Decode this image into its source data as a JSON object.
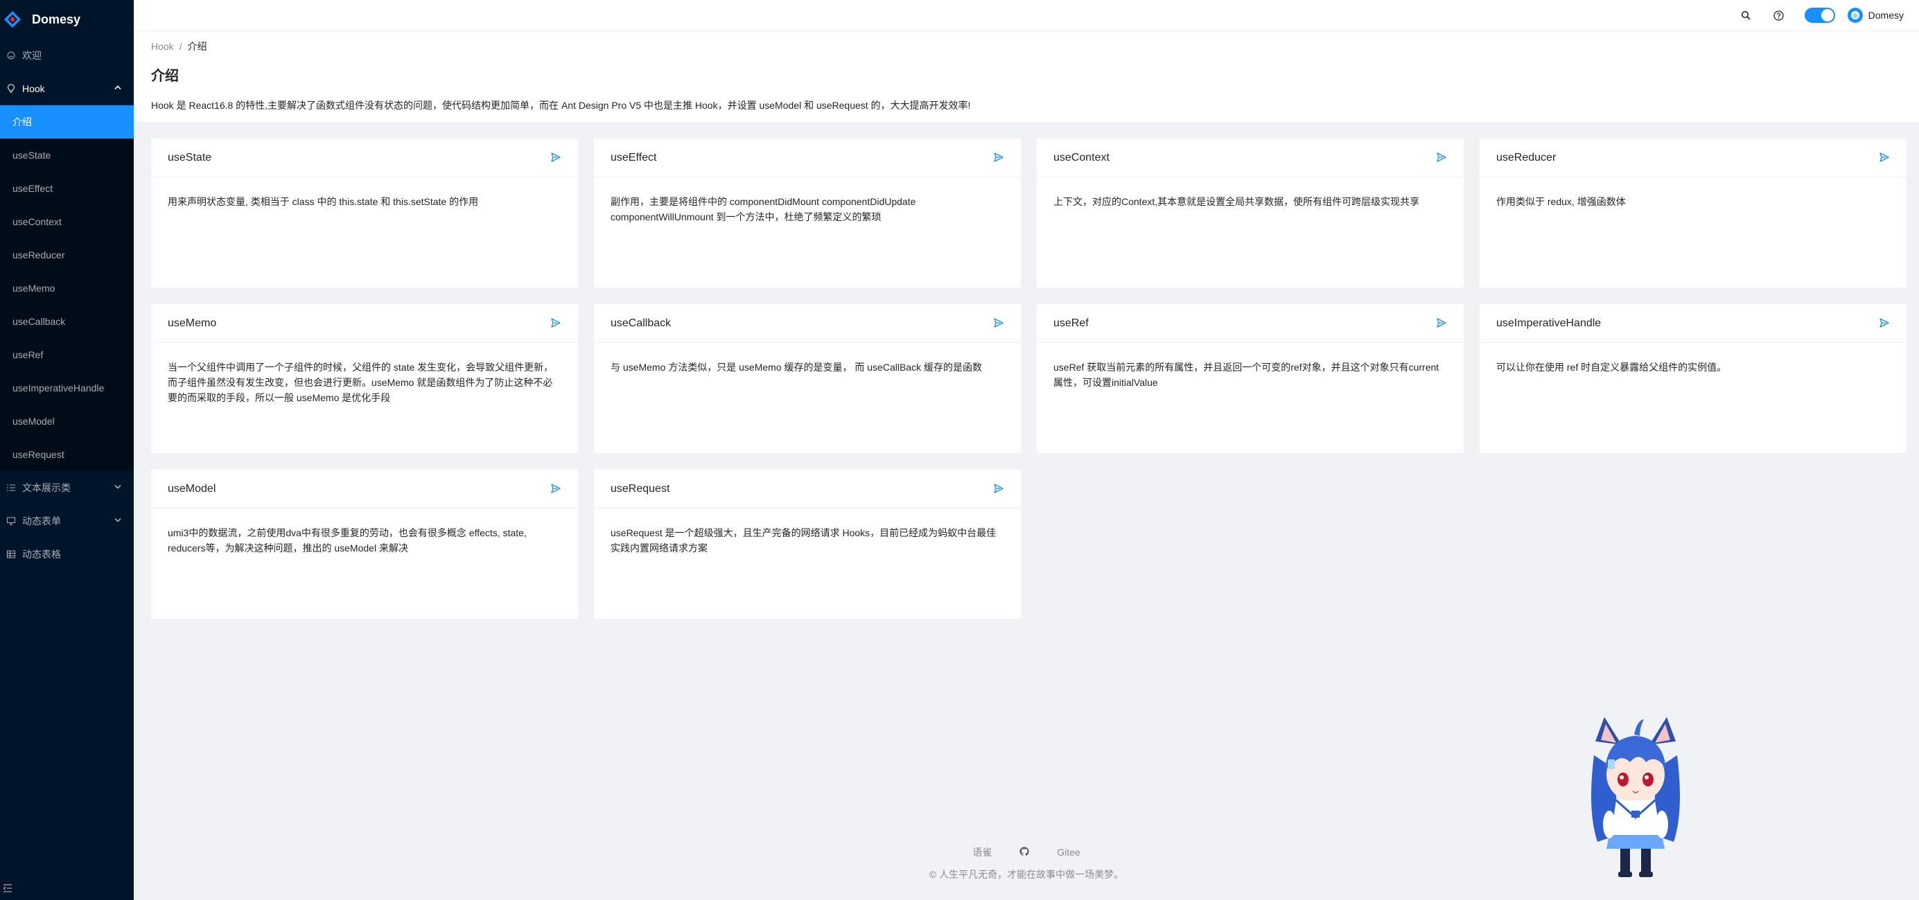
{
  "app": {
    "title": "Domesy"
  },
  "sidebar": {
    "items": [
      {
        "label": "欢迎",
        "icon": "smile-icon"
      },
      {
        "label": "Hook",
        "icon": "bulb-icon",
        "open": true
      },
      {
        "label": "文本展示类",
        "icon": "unordered-list-icon"
      },
      {
        "label": "动态表单",
        "icon": "desktop-icon"
      },
      {
        "label": "动态表格",
        "icon": "table-icon"
      }
    ],
    "hook_children": [
      "介绍",
      "useState",
      "useEffect",
      "useContext",
      "useReducer",
      "useMemo",
      "useCallback",
      "useRef",
      "useImperativeHandle",
      "useModel",
      "useRequest"
    ],
    "active": "介绍"
  },
  "header": {
    "user": "Domesy",
    "theme_switch": "on"
  },
  "page": {
    "breadcrumb": [
      "Hook",
      "介绍"
    ],
    "title": "介绍",
    "description": "Hook 是 React16.8 的特性,主要解决了函数式组件没有状态的问题，使代码结构更加简单，而在 Ant Design Pro V5 中也是主推 Hook，并设置 useModel 和 useRequest 的，大大提高开发效率!"
  },
  "cards": [
    {
      "title": "useState",
      "body": "用来声明状态变量, 类相当于 class 中的 this.state 和 this.setState 的作用"
    },
    {
      "title": "useEffect",
      "body": "副作用，主要是将组件中的 componentDidMount componentDidUpdate componentWillUnmount 到一个方法中，杜绝了频繁定义的繁琐"
    },
    {
      "title": "useContext",
      "body": "上下文，对应的Context,其本意就是设置全局共享数据，使所有组件可跨层级实现共享"
    },
    {
      "title": "useReducer",
      "body": "作用类似于 redux, 增强函数体"
    },
    {
      "title": "useMemo",
      "body": "当一个父组件中调用了一个子组件的时候，父组件的 state 发生变化，会导致父组件更新，而子组件虽然没有发生改变，但也会进行更新。useMemo 就是函数组件为了防止这种不必要的而采取的手段，所以一般 useMemo 是优化手段"
    },
    {
      "title": "useCallback",
      "body": "与 useMemo 方法类似，只是 useMemo 缓存的是变量， 而 useCallBack 缓存的是函数"
    },
    {
      "title": "useRef",
      "body": "useRef 获取当前元素的所有属性，并且返回一个可变的ref对象，并且这个对象只有current属性，可设置initialValue"
    },
    {
      "title": "useImperativeHandle",
      "body": "可以让你在使用 ref 时自定义暴露给父组件的实例值。"
    },
    {
      "title": "useModel",
      "body": "umi3中的数据流，之前使用dva中有很多重复的劳动，也会有很多概念 effects, state, reducers等，为解决这种问题，推出的 useModel 来解决"
    },
    {
      "title": "useRequest",
      "body": "useRequest 是一个超级强大，且生产完备的网络请求 Hooks，目前已经成为蚂蚁中台最佳实践内置网络请求方案"
    }
  ],
  "footer": {
    "links": [
      "语雀",
      "Gitee"
    ],
    "copyright": "人生平凡无奇，才能在故事中做一场美梦。"
  },
  "colors": {
    "primary": "#1890ff",
    "sider": "#001529",
    "bg": "#f0f2f5"
  }
}
